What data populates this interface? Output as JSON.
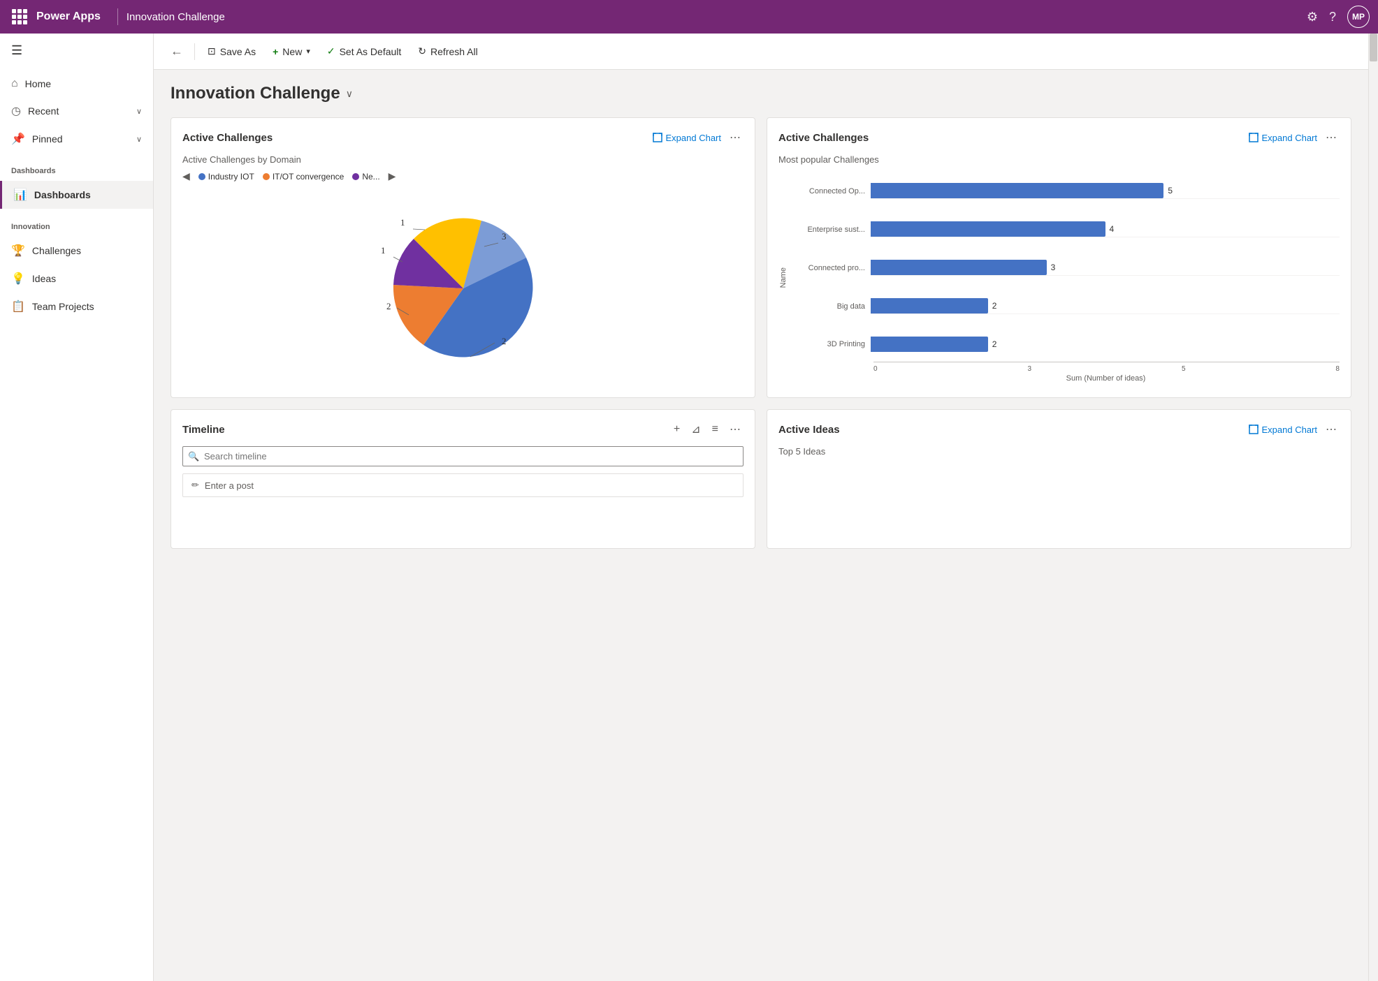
{
  "topNav": {
    "logo": "Power Apps",
    "title": "Innovation Challenge",
    "avatar": "MP"
  },
  "toolbar": {
    "back": "←",
    "saveAs": "Save As",
    "new": "New",
    "newDropdown": "▾",
    "setAsDefault": "Set As Default",
    "refreshAll": "Refresh All"
  },
  "sidebar": {
    "hamburgerIcon": "☰",
    "items": [
      {
        "id": "home",
        "label": "Home",
        "icon": "⌂",
        "hasChevron": false,
        "active": false
      },
      {
        "id": "recent",
        "label": "Recent",
        "icon": "◷",
        "hasChevron": true,
        "active": false
      },
      {
        "id": "pinned",
        "label": "Pinned",
        "icon": "📌",
        "hasChevron": true,
        "active": false
      }
    ],
    "dashboardsGroup": "Dashboards",
    "dashboardItems": [
      {
        "id": "dashboards",
        "label": "Dashboards",
        "icon": "📊",
        "active": true
      }
    ],
    "innovationGroup": "Innovation",
    "innovationItems": [
      {
        "id": "challenges",
        "label": "Challenges",
        "icon": "🏆",
        "active": false
      },
      {
        "id": "ideas",
        "label": "Ideas",
        "icon": "💡",
        "active": false
      },
      {
        "id": "teamProjects",
        "label": "Team Projects",
        "icon": "📋",
        "active": false
      }
    ]
  },
  "pageTitle": "Innovation Challenge",
  "charts": {
    "activeChallenges1": {
      "title": "Active Challenges",
      "expandLabel": "Expand Chart",
      "subtitle": "Active Challenges by Domain",
      "legend": [
        {
          "label": "Industry IOT",
          "color": "#4472c4"
        },
        {
          "label": "IT/OT convergence",
          "color": "#ed7d31"
        },
        {
          "label": "Ne...",
          "color": "#7030a0"
        }
      ],
      "pieSlices": [
        {
          "label": "3",
          "value": 3,
          "color": "#4472c4",
          "startAngle": -30,
          "endAngle": 100
        },
        {
          "label": "2",
          "value": 2,
          "color": "#ed7d31",
          "startAngle": 100,
          "endAngle": 190
        },
        {
          "label": "1",
          "value": 1,
          "color": "#7030a0",
          "startAngle": 190,
          "endAngle": 235
        },
        {
          "label": "1",
          "value": 1,
          "color": "#ffc000",
          "startAngle": 235,
          "endAngle": 300
        },
        {
          "label": "2",
          "value": 2,
          "color": "#4472c4",
          "startAngle": 300,
          "endAngle": 330
        }
      ]
    },
    "activeChallenges2": {
      "title": "Active Challenges",
      "expandLabel": "Expand Chart",
      "subtitle": "Most popular Challenges",
      "yAxisLabel": "Name",
      "xAxisLabel": "Sum (Number of ideas)",
      "bars": [
        {
          "label": "Connected Op...",
          "value": 5,
          "maxValue": 8
        },
        {
          "label": "Enterprise sust...",
          "value": 4,
          "maxValue": 8
        },
        {
          "label": "Connected pro...",
          "value": 3,
          "maxValue": 8
        },
        {
          "label": "Big data",
          "value": 2,
          "maxValue": 8
        },
        {
          "label": "3D Printing",
          "value": 2,
          "maxValue": 8
        }
      ],
      "xAxisTicks": [
        "0",
        "3",
        "5",
        "8"
      ]
    },
    "timeline": {
      "title": "Timeline",
      "searchPlaceholder": "Search timeline",
      "postPlaceholder": "Enter a post"
    },
    "activeIdeas": {
      "title": "Active Ideas",
      "expandLabel": "Expand Chart",
      "subtitle": "Top 5 Ideas"
    }
  }
}
